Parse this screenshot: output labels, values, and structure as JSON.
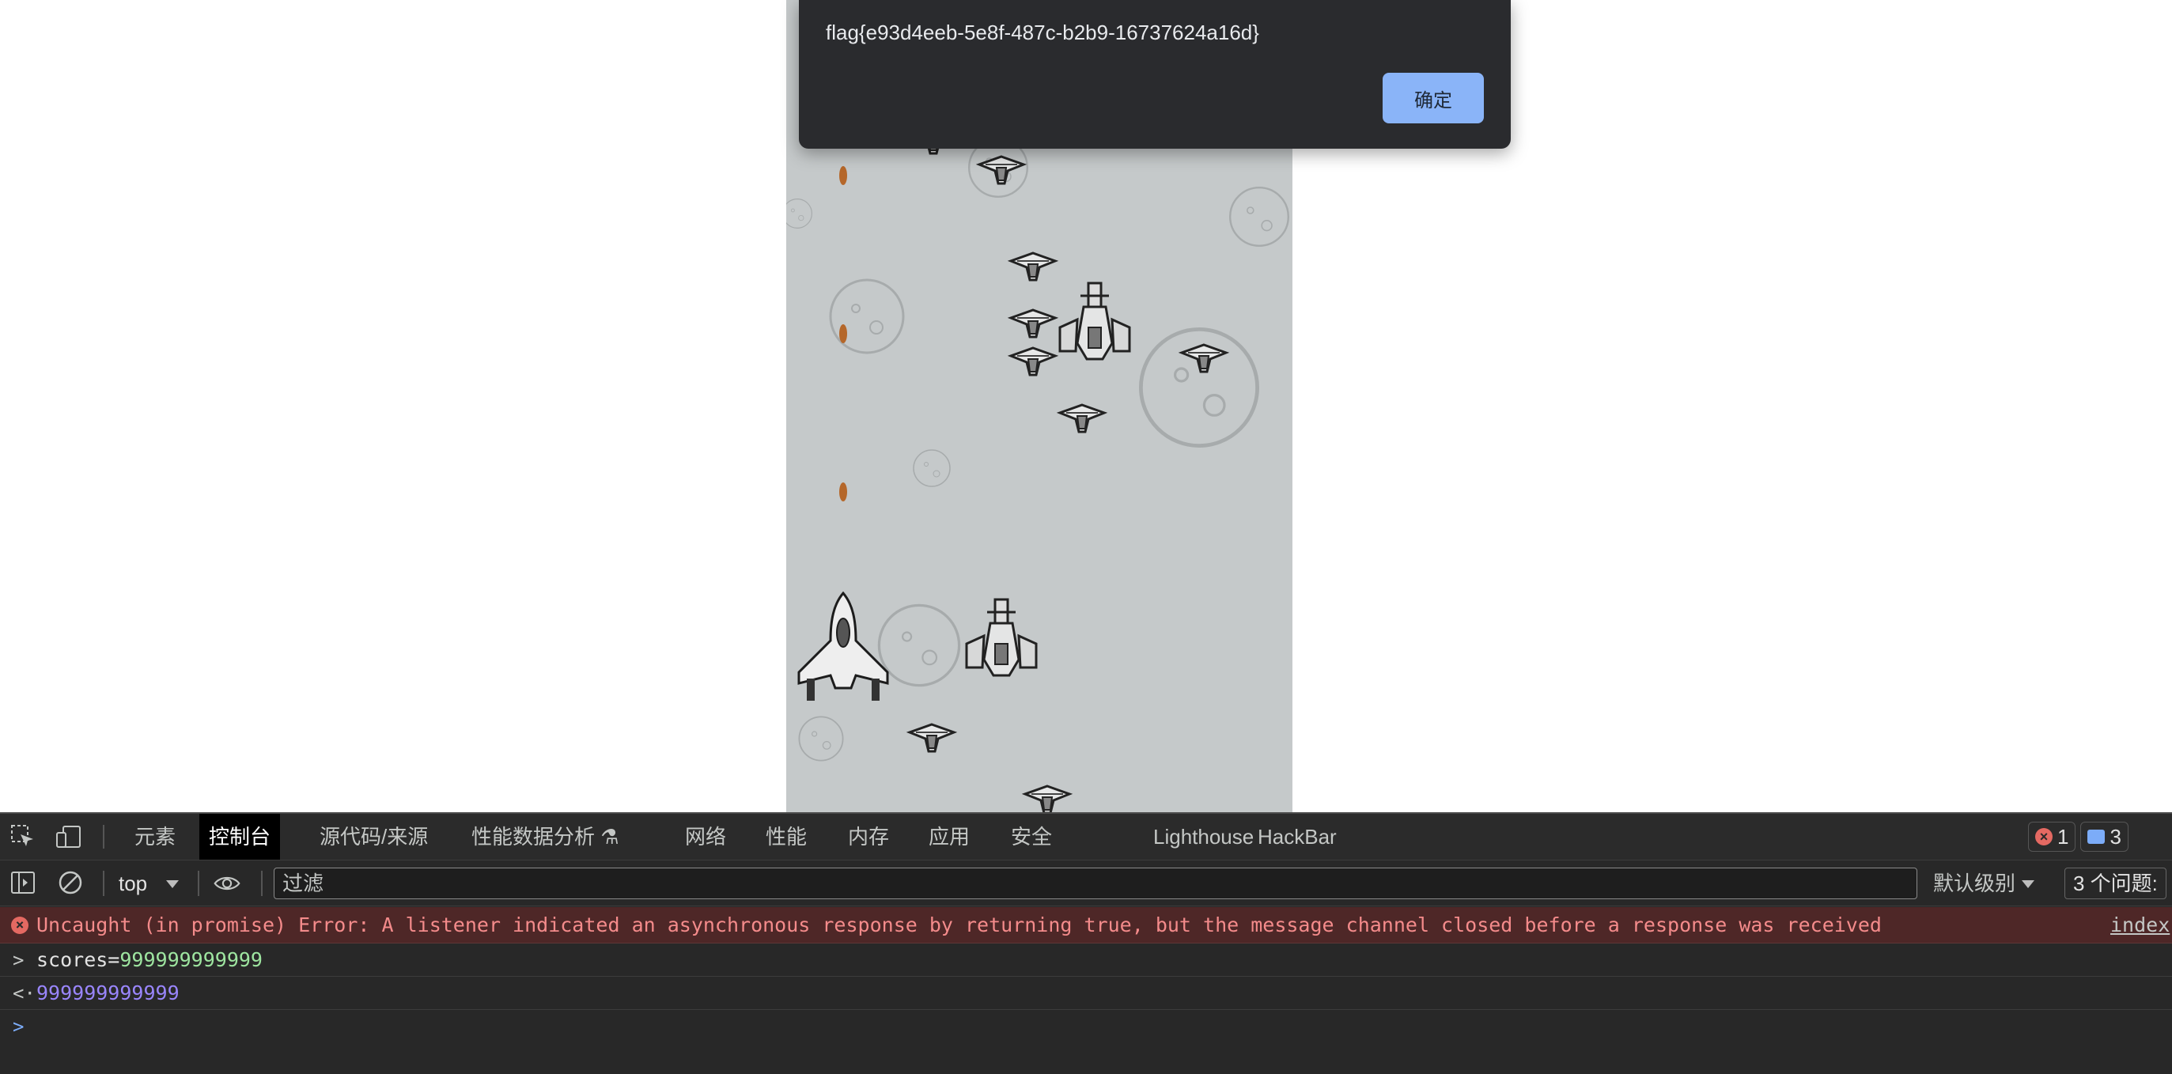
{
  "alert": {
    "message": "flag{e93d4eeb-5e8f-487c-b2b9-16737624a16d}",
    "ok_label": "确定"
  },
  "devtools": {
    "tabs": [
      "元素",
      "控制台",
      "源代码/来源",
      "性能数据分析 ⚗",
      "网络",
      "性能",
      "内存",
      "应用",
      "安全",
      "Lighthouse",
      "HackBar"
    ],
    "active_tab": "控制台",
    "error_count": "1",
    "message_count": "3",
    "context": "top",
    "filter_placeholder": "过滤",
    "levels_label": "默认级别",
    "issues_label": "3 个问题:",
    "console": {
      "error_message": "Uncaught (in promise) Error: A listener indicated an asynchronous response by returning true, but the message channel closed before a response was received",
      "error_source": "index",
      "input_prefix": "scores=",
      "input_value": "999999999999",
      "result": "999999999999"
    }
  },
  "colors": {
    "accent": "#8ab4f8",
    "error_bg": "#4e2727",
    "game_bg": "#c5c9ca"
  },
  "icons": [
    "inspect-icon",
    "device-toggle-icon",
    "sidebar-icon",
    "clear-console-icon",
    "eye-icon"
  ]
}
